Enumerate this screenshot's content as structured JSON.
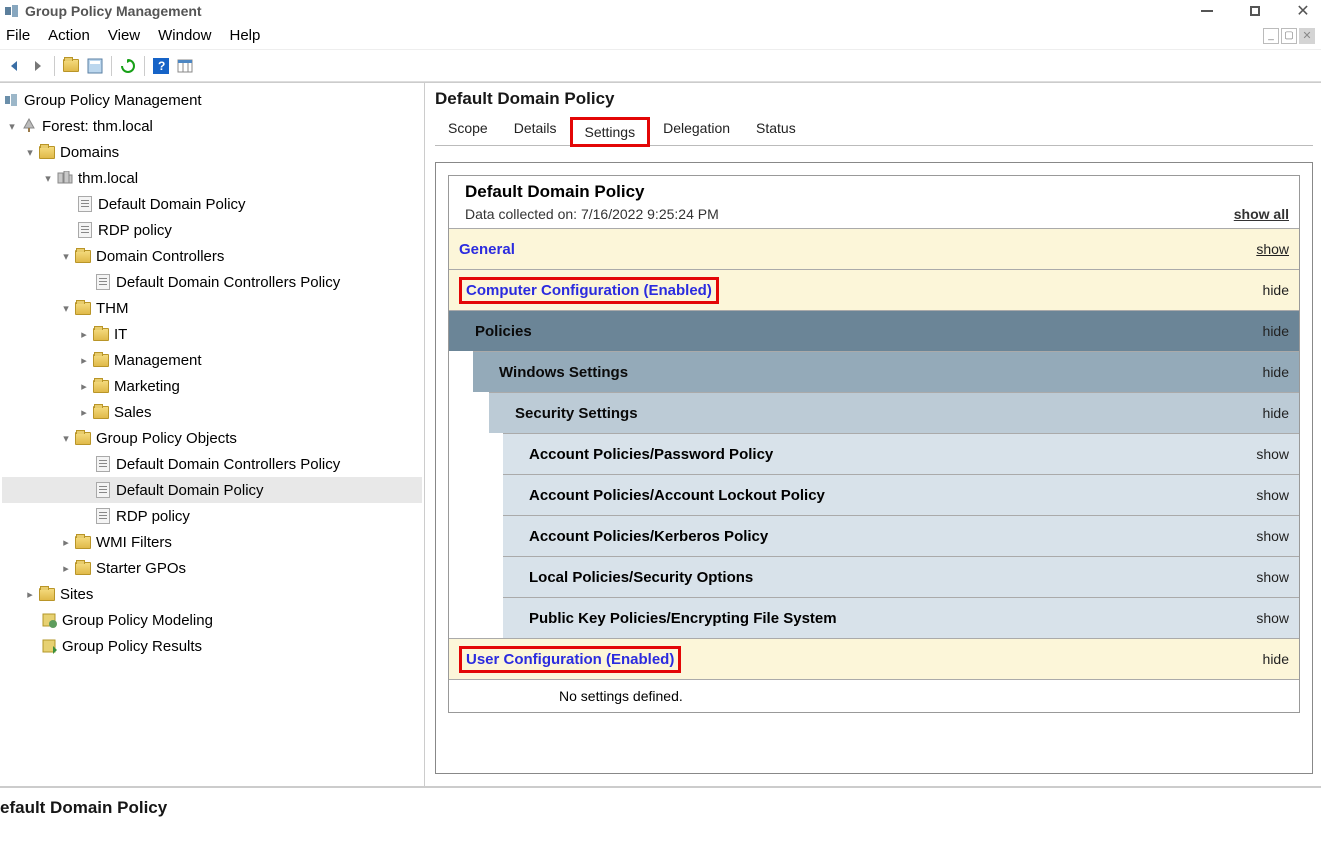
{
  "window": {
    "title": "Group Policy Management"
  },
  "menu": {
    "file": "File",
    "action": "Action",
    "view": "View",
    "window": "Window",
    "help": "Help"
  },
  "tree": {
    "root": "Group Policy Management",
    "forest": "Forest: thm.local",
    "domains": "Domains",
    "domain_name": "thm.local",
    "default_domain_policy": "Default Domain Policy",
    "rdp_policy": "RDP policy",
    "domain_controllers": "Domain Controllers",
    "default_dc_policy": "Default Domain Controllers Policy",
    "thm": "THM",
    "it": "IT",
    "management": "Management",
    "marketing": "Marketing",
    "sales": "Sales",
    "gpo": "Group Policy Objects",
    "gpo_default_dc": "Default Domain Controllers Policy",
    "gpo_default_domain": "Default Domain Policy",
    "gpo_rdp": "RDP policy",
    "wmi": "WMI Filters",
    "starter": "Starter GPOs",
    "sites": "Sites",
    "modeling": "Group Policy Modeling",
    "results": "Group Policy Results"
  },
  "right": {
    "title": "Default Domain Policy",
    "tabs": {
      "scope": "Scope",
      "details": "Details",
      "settings": "Settings",
      "delegation": "Delegation",
      "status": "Status"
    },
    "report": {
      "name": "Default Domain Policy",
      "collected_label": "Data collected on:",
      "collected_value": "7/16/2022 9:25:24 PM",
      "show_all": "show all",
      "general": "General",
      "general_action": "show",
      "computer_config": "Computer Configuration (Enabled)",
      "computer_config_action": "hide",
      "policies": "Policies",
      "policies_action": "hide",
      "windows_settings": "Windows Settings",
      "windows_settings_action": "hide",
      "security_settings": "Security Settings",
      "security_settings_action": "hide",
      "items": [
        {
          "label": "Account Policies/Password Policy",
          "action": "show"
        },
        {
          "label": "Account Policies/Account Lockout Policy",
          "action": "show"
        },
        {
          "label": "Account Policies/Kerberos Policy",
          "action": "show"
        },
        {
          "label": "Local Policies/Security Options",
          "action": "show"
        },
        {
          "label": "Public Key Policies/Encrypting File System",
          "action": "show"
        }
      ],
      "user_config": "User Configuration (Enabled)",
      "user_config_action": "hide",
      "no_settings": "No settings defined."
    }
  },
  "bottom": {
    "label": "efault Domain Policy"
  }
}
